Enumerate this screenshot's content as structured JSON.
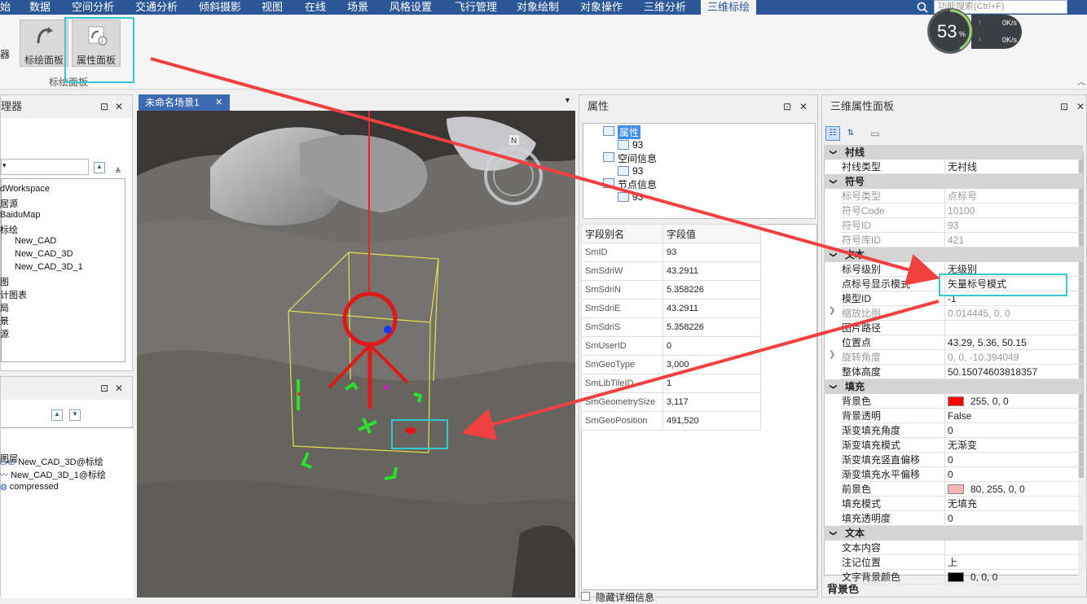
{
  "menu": {
    "items": [
      "始",
      "数据",
      "空间分析",
      "交通分析",
      "倾斜摄影",
      "视图",
      "在线",
      "场景",
      "风格设置",
      "飞行管理",
      "对象绘制",
      "对象操作",
      "三维分析",
      "三维标绘"
    ],
    "active_index": 13,
    "search_placeholder": "功能搜索(Ctrl+F)"
  },
  "ribbon": {
    "left_stub": "器",
    "btn_plot_panel": "标绘面板",
    "btn_attr_panel": "属性面板",
    "group_label": "标绘面板"
  },
  "speed_widget": {
    "percent": "53",
    "percent_unit": "%",
    "up": "0K/s",
    "down": "0K/s"
  },
  "workspace_panel": {
    "title": "理器",
    "pin": "⊡",
    "close": "✕",
    "tree": [
      "dWorkspace",
      "居源",
      "BaiduMap",
      "标绘",
      "New_CAD",
      "New_CAD_3D",
      "New_CAD_3D_1",
      "图",
      "计图表",
      "局",
      "景",
      "源"
    ]
  },
  "layer_panel": {
    "tree": [
      "图层",
      "New_CAD_3D@标绘",
      "New_CAD_3D_1@标绘",
      "compressed"
    ],
    "cad_tag": "CAD"
  },
  "scene_tab": {
    "label": "未命名场景1",
    "close": "✕",
    "compass": "N"
  },
  "attr_panel": {
    "title": "属性",
    "tree": [
      "属性",
      "93",
      "空间信息",
      "93",
      "节点信息",
      "93"
    ],
    "table_headers": [
      "字段别名",
      "字段值"
    ],
    "rows": [
      [
        "SmID",
        "93"
      ],
      [
        "SmSdriW",
        "43.2911"
      ],
      [
        "SmSdriN",
        "5.358226"
      ],
      [
        "SmSdriE",
        "43.2911"
      ],
      [
        "SmSdriS",
        "5.358226"
      ],
      [
        "SmUserID",
        "0"
      ],
      [
        "SmGeoType",
        "3,000"
      ],
      [
        "SmLibTileID",
        "1"
      ],
      [
        "SmGeometrySize",
        "3,117"
      ],
      [
        "SmGeoPosition",
        "491,520"
      ]
    ],
    "hide_detail": "隐藏详细信息"
  },
  "prop_panel": {
    "title": "三维属性面板",
    "footer": "背景色",
    "sections": [
      {
        "name": "衬线",
        "rows": [
          [
            "衬线类型",
            "无衬线",
            ""
          ]
        ]
      },
      {
        "name": "符号",
        "rows": [
          [
            "标号类型",
            "点标号",
            "dis"
          ],
          [
            "符号Code",
            "10100",
            "dis"
          ],
          [
            "符号ID",
            "93",
            "dis"
          ],
          [
            "符号库ID",
            "421",
            "dis"
          ]
        ]
      },
      {
        "name": "文本",
        "rows": [
          [
            "标号级别",
            "无级别",
            ""
          ],
          [
            "点标号显示模式",
            "矢量标号模式",
            ""
          ],
          [
            "模型ID",
            "-1",
            ""
          ],
          [
            "缩放比例",
            "0.014445, 0, 0",
            "dis"
          ],
          [
            "图片路径",
            "",
            ""
          ],
          [
            "位置点",
            "43.29, 5.36, 50.15",
            ""
          ],
          [
            "旋转角度",
            "0, 0, -10.394049",
            "dis"
          ],
          [
            "整体高度",
            "50.15074603818357",
            ""
          ]
        ]
      },
      {
        "name": "填充",
        "rows": [
          [
            "背景色",
            "255, 0, 0",
            ""
          ],
          [
            "背景透明",
            "False",
            ""
          ],
          [
            "渐变填充角度",
            "0",
            ""
          ],
          [
            "渐变填充模式",
            "无渐变",
            ""
          ],
          [
            "渐变填充竖直偏移",
            "0",
            ""
          ],
          [
            "渐变填充水平偏移",
            "0",
            ""
          ],
          [
            "前景色",
            "80, 255, 0, 0",
            ""
          ],
          [
            "填充模式",
            "无填充",
            ""
          ],
          [
            "填充透明度",
            "0",
            ""
          ]
        ]
      },
      {
        "name": "文本",
        "rows": [
          [
            "文本内容",
            "",
            ""
          ],
          [
            "注记位置",
            "上",
            ""
          ],
          [
            "文字背景颜色",
            "0, 0, 0",
            ""
          ]
        ]
      }
    ],
    "colors": {
      "bg": "#ff0000",
      "fg": "#f7b6b6",
      "text_bg": "#000000"
    }
  },
  "colors": {
    "menubar": "#2b5797",
    "highlight": "#35c8d0",
    "arrow": "#f04040"
  }
}
